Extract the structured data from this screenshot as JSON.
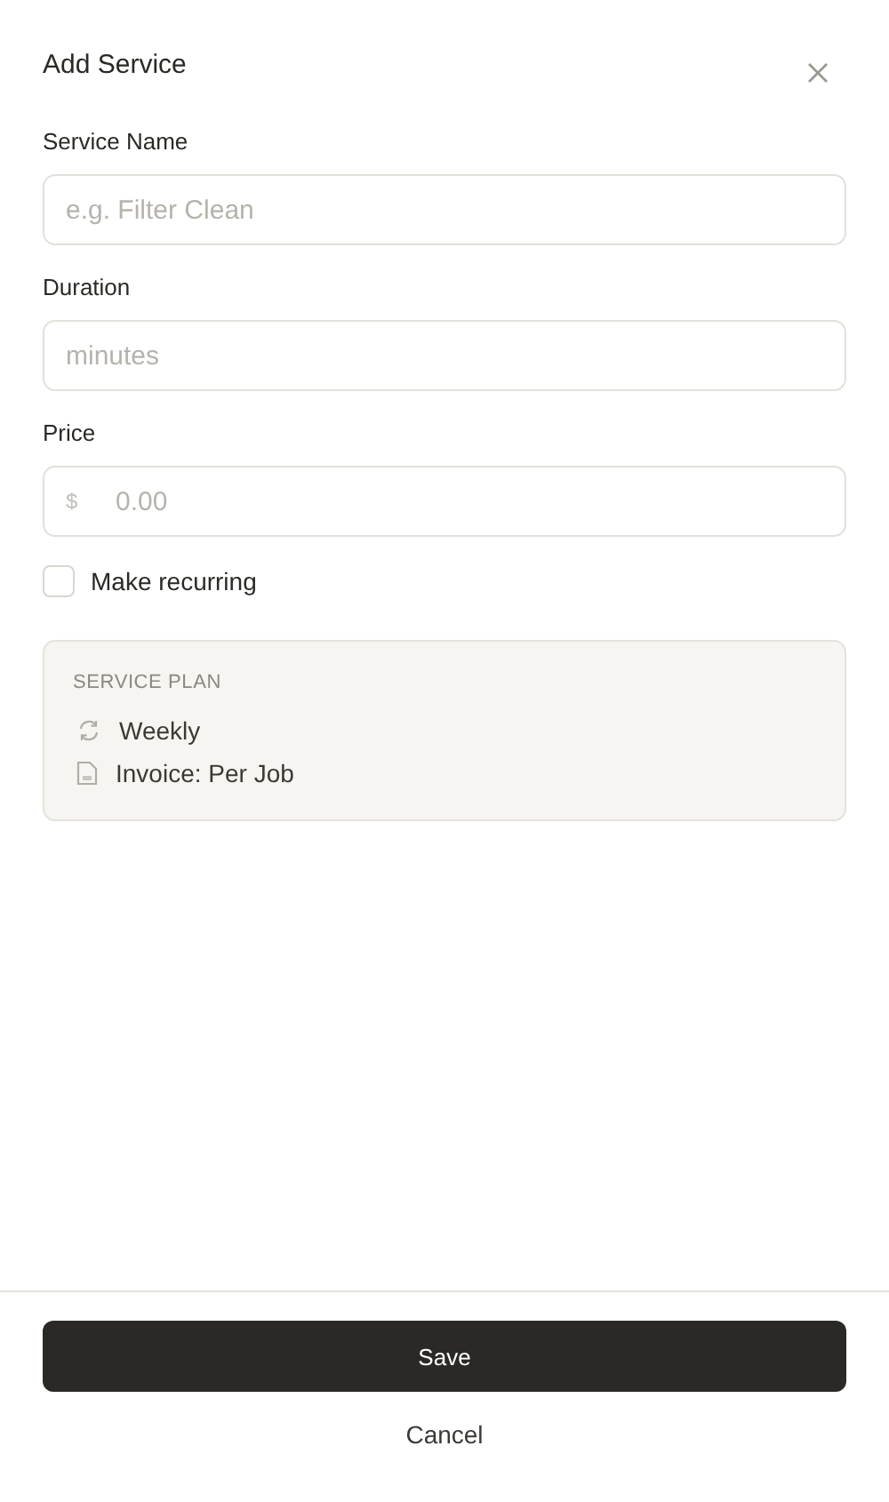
{
  "dialog": {
    "title": "Add Service"
  },
  "fields": [
    {
      "kind": "text",
      "label": "Service Name",
      "placeholder": "e.g. Filter Clean"
    },
    {
      "kind": "text",
      "label": "Duration",
      "placeholder": "minutes"
    },
    {
      "kind": "currency",
      "label": "Price",
      "prefix": "$",
      "placeholder": "0.00"
    }
  ],
  "recurring": {
    "label": "Make recurring",
    "checked": false
  },
  "plan": {
    "heading": "SERVICE PLAN",
    "items": [
      {
        "kind": "frequency",
        "text": "Weekly"
      },
      {
        "kind": "invoice",
        "text": "Invoice: Per Job"
      }
    ]
  },
  "buttons": {
    "save": "Save",
    "cancel": "Cancel"
  }
}
